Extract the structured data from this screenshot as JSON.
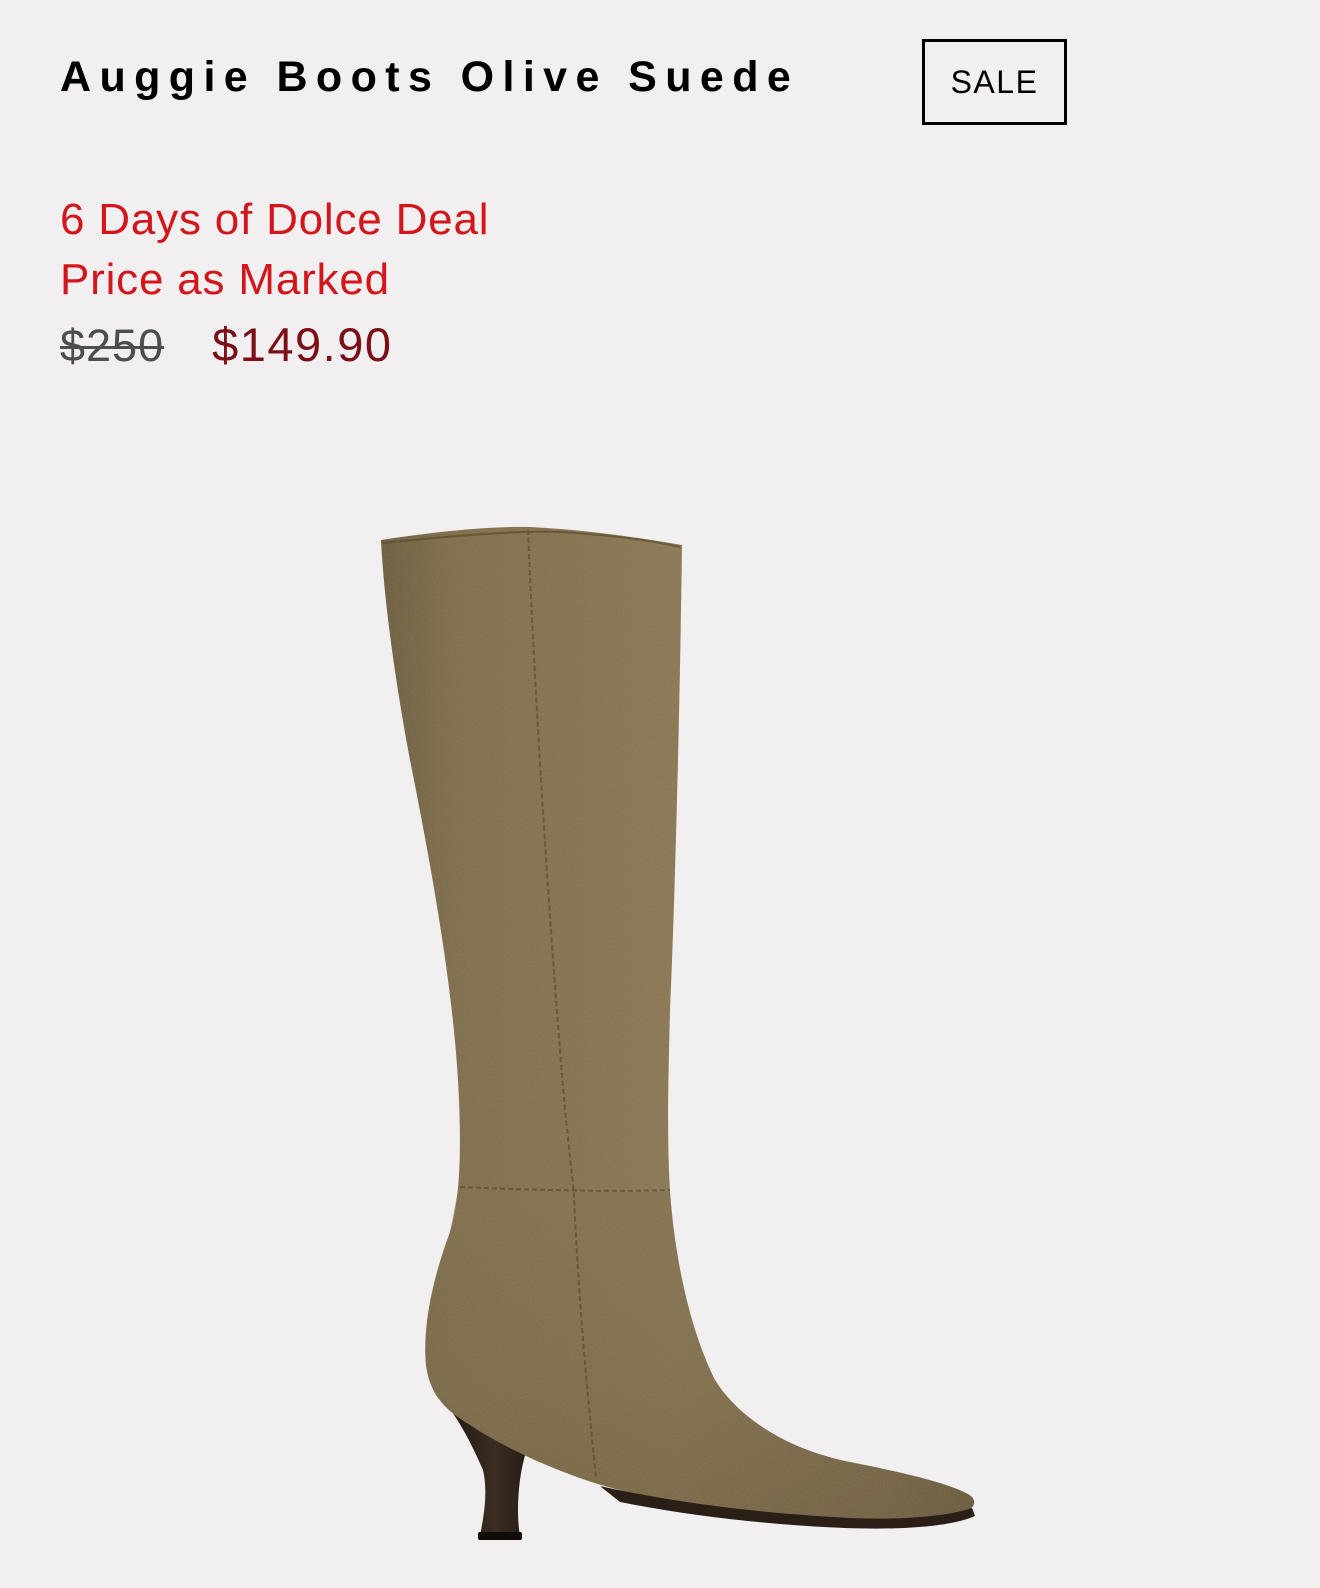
{
  "product": {
    "title": "Auggie Boots Olive Suede",
    "badge": "SALE",
    "promo_line1": "6 Days of Dolce Deal",
    "promo_line2": "Price as Marked",
    "price_original": "$250",
    "price_sale": "$149.90",
    "image_subject": "olive suede knee-high boot with pointed toe and kitten heel"
  },
  "colors": {
    "background": "#f1eff0",
    "promo_red": "#d2161b",
    "sale_price": "#7b0e16",
    "original_price": "#4d4d4d",
    "boot_suede": "#7d6a44"
  }
}
